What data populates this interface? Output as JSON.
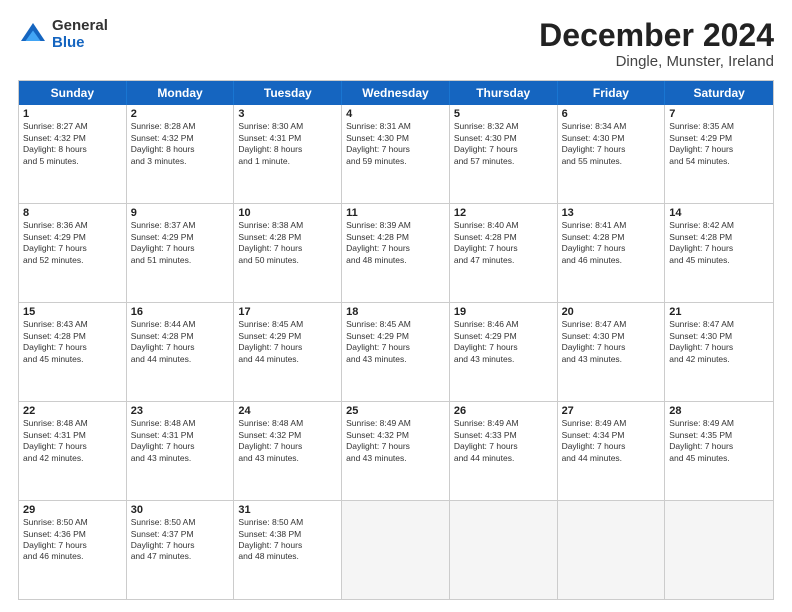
{
  "header": {
    "logo_general": "General",
    "logo_blue": "Blue",
    "month_title": "December 2024",
    "location": "Dingle, Munster, Ireland"
  },
  "days_of_week": [
    "Sunday",
    "Monday",
    "Tuesday",
    "Wednesday",
    "Thursday",
    "Friday",
    "Saturday"
  ],
  "weeks": [
    [
      {
        "day": "1",
        "info": "Sunrise: 8:27 AM\nSunset: 4:32 PM\nDaylight: 8 hours\nand 5 minutes."
      },
      {
        "day": "2",
        "info": "Sunrise: 8:28 AM\nSunset: 4:32 PM\nDaylight: 8 hours\nand 3 minutes."
      },
      {
        "day": "3",
        "info": "Sunrise: 8:30 AM\nSunset: 4:31 PM\nDaylight: 8 hours\nand 1 minute."
      },
      {
        "day": "4",
        "info": "Sunrise: 8:31 AM\nSunset: 4:30 PM\nDaylight: 7 hours\nand 59 minutes."
      },
      {
        "day": "5",
        "info": "Sunrise: 8:32 AM\nSunset: 4:30 PM\nDaylight: 7 hours\nand 57 minutes."
      },
      {
        "day": "6",
        "info": "Sunrise: 8:34 AM\nSunset: 4:30 PM\nDaylight: 7 hours\nand 55 minutes."
      },
      {
        "day": "7",
        "info": "Sunrise: 8:35 AM\nSunset: 4:29 PM\nDaylight: 7 hours\nand 54 minutes."
      }
    ],
    [
      {
        "day": "8",
        "info": "Sunrise: 8:36 AM\nSunset: 4:29 PM\nDaylight: 7 hours\nand 52 minutes."
      },
      {
        "day": "9",
        "info": "Sunrise: 8:37 AM\nSunset: 4:29 PM\nDaylight: 7 hours\nand 51 minutes."
      },
      {
        "day": "10",
        "info": "Sunrise: 8:38 AM\nSunset: 4:28 PM\nDaylight: 7 hours\nand 50 minutes."
      },
      {
        "day": "11",
        "info": "Sunrise: 8:39 AM\nSunset: 4:28 PM\nDaylight: 7 hours\nand 48 minutes."
      },
      {
        "day": "12",
        "info": "Sunrise: 8:40 AM\nSunset: 4:28 PM\nDaylight: 7 hours\nand 47 minutes."
      },
      {
        "day": "13",
        "info": "Sunrise: 8:41 AM\nSunset: 4:28 PM\nDaylight: 7 hours\nand 46 minutes."
      },
      {
        "day": "14",
        "info": "Sunrise: 8:42 AM\nSunset: 4:28 PM\nDaylight: 7 hours\nand 45 minutes."
      }
    ],
    [
      {
        "day": "15",
        "info": "Sunrise: 8:43 AM\nSunset: 4:28 PM\nDaylight: 7 hours\nand 45 minutes."
      },
      {
        "day": "16",
        "info": "Sunrise: 8:44 AM\nSunset: 4:28 PM\nDaylight: 7 hours\nand 44 minutes."
      },
      {
        "day": "17",
        "info": "Sunrise: 8:45 AM\nSunset: 4:29 PM\nDaylight: 7 hours\nand 44 minutes."
      },
      {
        "day": "18",
        "info": "Sunrise: 8:45 AM\nSunset: 4:29 PM\nDaylight: 7 hours\nand 43 minutes."
      },
      {
        "day": "19",
        "info": "Sunrise: 8:46 AM\nSunset: 4:29 PM\nDaylight: 7 hours\nand 43 minutes."
      },
      {
        "day": "20",
        "info": "Sunrise: 8:47 AM\nSunset: 4:30 PM\nDaylight: 7 hours\nand 43 minutes."
      },
      {
        "day": "21",
        "info": "Sunrise: 8:47 AM\nSunset: 4:30 PM\nDaylight: 7 hours\nand 42 minutes."
      }
    ],
    [
      {
        "day": "22",
        "info": "Sunrise: 8:48 AM\nSunset: 4:31 PM\nDaylight: 7 hours\nand 42 minutes."
      },
      {
        "day": "23",
        "info": "Sunrise: 8:48 AM\nSunset: 4:31 PM\nDaylight: 7 hours\nand 43 minutes."
      },
      {
        "day": "24",
        "info": "Sunrise: 8:48 AM\nSunset: 4:32 PM\nDaylight: 7 hours\nand 43 minutes."
      },
      {
        "day": "25",
        "info": "Sunrise: 8:49 AM\nSunset: 4:32 PM\nDaylight: 7 hours\nand 43 minutes."
      },
      {
        "day": "26",
        "info": "Sunrise: 8:49 AM\nSunset: 4:33 PM\nDaylight: 7 hours\nand 44 minutes."
      },
      {
        "day": "27",
        "info": "Sunrise: 8:49 AM\nSunset: 4:34 PM\nDaylight: 7 hours\nand 44 minutes."
      },
      {
        "day": "28",
        "info": "Sunrise: 8:49 AM\nSunset: 4:35 PM\nDaylight: 7 hours\nand 45 minutes."
      }
    ],
    [
      {
        "day": "29",
        "info": "Sunrise: 8:50 AM\nSunset: 4:36 PM\nDaylight: 7 hours\nand 46 minutes."
      },
      {
        "day": "30",
        "info": "Sunrise: 8:50 AM\nSunset: 4:37 PM\nDaylight: 7 hours\nand 47 minutes."
      },
      {
        "day": "31",
        "info": "Sunrise: 8:50 AM\nSunset: 4:38 PM\nDaylight: 7 hours\nand 48 minutes."
      },
      {
        "day": "",
        "info": ""
      },
      {
        "day": "",
        "info": ""
      },
      {
        "day": "",
        "info": ""
      },
      {
        "day": "",
        "info": ""
      }
    ]
  ]
}
